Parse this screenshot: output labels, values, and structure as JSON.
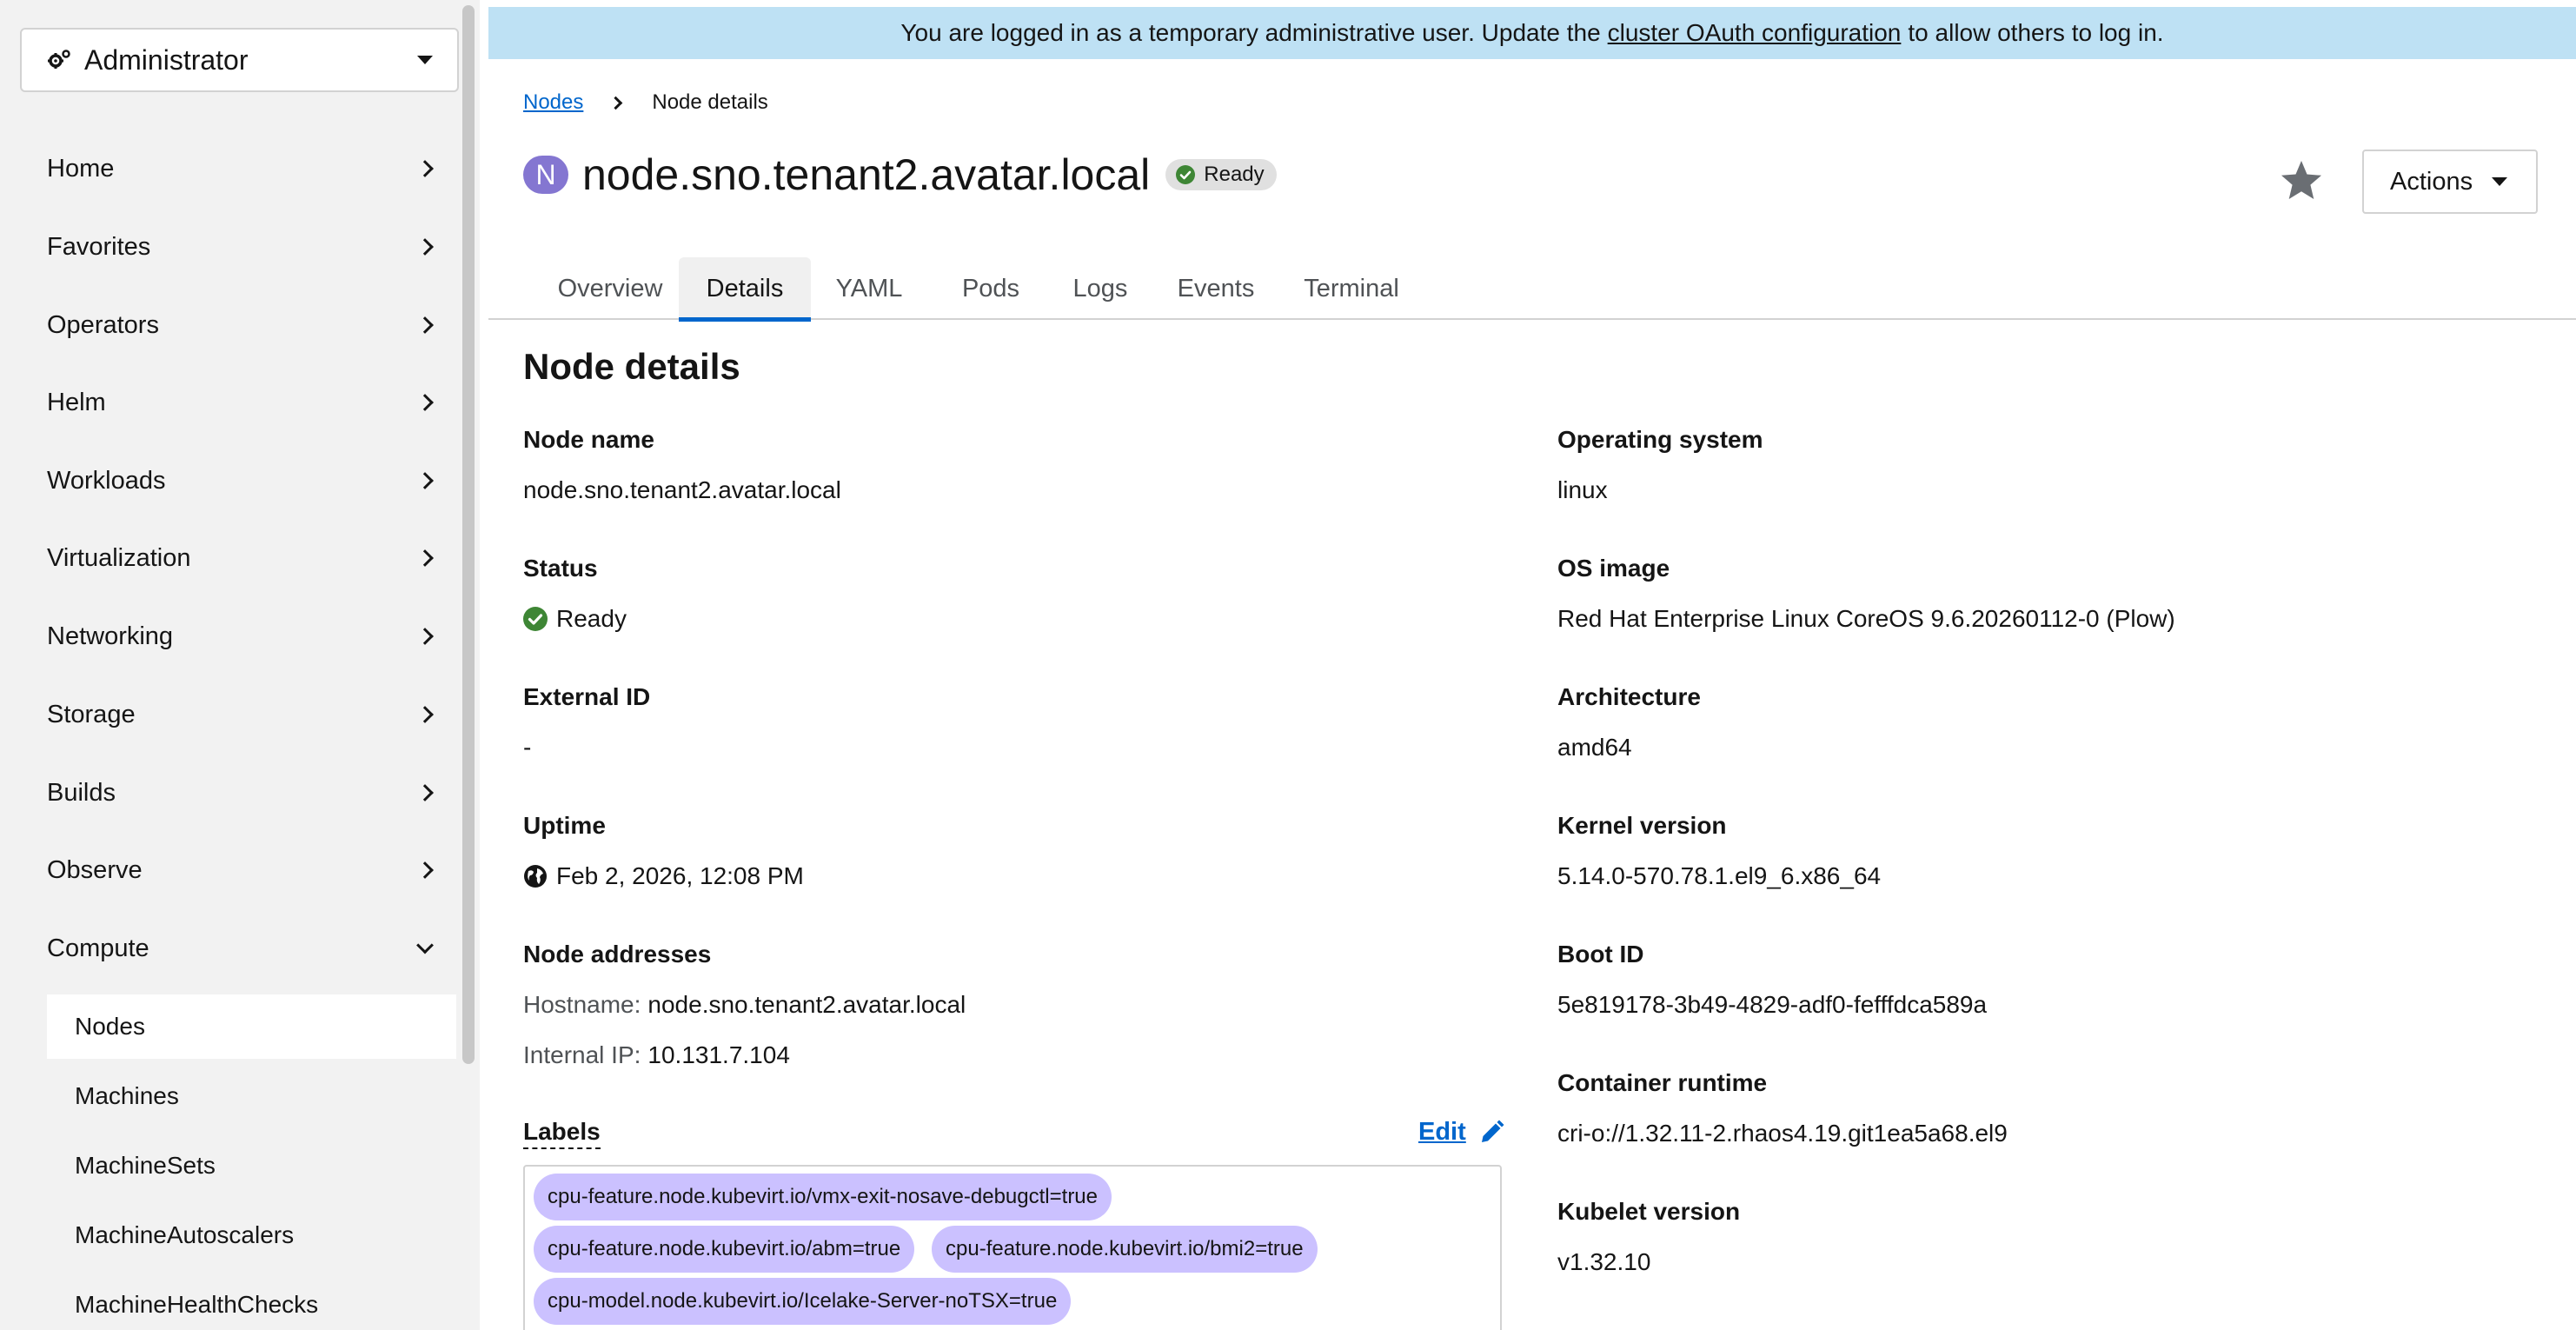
{
  "sidebar": {
    "perspective": "Administrator",
    "items": [
      {
        "label": "Home"
      },
      {
        "label": "Favorites"
      },
      {
        "label": "Operators"
      },
      {
        "label": "Helm"
      },
      {
        "label": "Workloads"
      },
      {
        "label": "Virtualization"
      },
      {
        "label": "Networking"
      },
      {
        "label": "Storage"
      },
      {
        "label": "Builds"
      },
      {
        "label": "Observe"
      },
      {
        "label": "Compute"
      }
    ],
    "compute_items": [
      {
        "label": "Nodes",
        "active": true
      },
      {
        "label": "Machines"
      },
      {
        "label": "MachineSets"
      },
      {
        "label": "MachineAutoscalers"
      },
      {
        "label": "MachineHealthChecks"
      }
    ]
  },
  "banner": {
    "prefix": "You are logged in as a temporary administrative user. Update the",
    "link": "cluster OAuth configuration",
    "suffix": "to allow others to log in."
  },
  "breadcrumb": {
    "parent": "Nodes",
    "current": "Node details"
  },
  "header": {
    "badge": "N",
    "title": "node.sno.tenant2.avatar.local",
    "status": "Ready",
    "actions_label": "Actions"
  },
  "tabs": [
    "Overview",
    "Details",
    "YAML",
    "Pods",
    "Logs",
    "Events",
    "Terminal"
  ],
  "active_tab": "Details",
  "details": {
    "section_title": "Node details",
    "node_name_label": "Node name",
    "node_name": "node.sno.tenant2.avatar.local",
    "status_label": "Status",
    "status": "Ready",
    "external_id_label": "External ID",
    "external_id": "-",
    "uptime_label": "Uptime",
    "uptime": "Feb 2, 2026, 12:08 PM",
    "addresses_label": "Node addresses",
    "hostname_key": "Hostname:",
    "hostname": "node.sno.tenant2.avatar.local",
    "internal_ip_key": "Internal IP:",
    "internal_ip": "10.131.7.104",
    "os_label": "Operating system",
    "os": "linux",
    "os_image_label": "OS image",
    "os_image": "Red Hat Enterprise Linux CoreOS 9.6.20260112-0 (Plow)",
    "arch_label": "Architecture",
    "arch": "amd64",
    "kernel_label": "Kernel version",
    "kernel": "5.14.0-570.78.1.el9_6.x86_64",
    "boot_id_label": "Boot ID",
    "boot_id": "5e819178-3b49-4829-adf0-fefffdca589a",
    "runtime_label": "Container runtime",
    "runtime": "cri-o://1.32.11-2.rhaos4.19.git1ea5a68.el9",
    "kubelet_label": "Kubelet version",
    "kubelet": "v1.32.10"
  },
  "labels": {
    "title": "Labels",
    "edit": "Edit",
    "chips": [
      "cpu-feature.node.kubevirt.io/vmx-exit-nosave-debugctl=true",
      "cpu-feature.node.kubevirt.io/abm=true",
      "cpu-feature.node.kubevirt.io/bmi2=true",
      "cpu-model.node.kubevirt.io/Icelake-Server-noTSX=true"
    ]
  },
  "colors": {
    "banner_bg": "#bee1f4",
    "link": "#0066cc",
    "ready_green": "#3e8635",
    "badge_purple": "#8476d1",
    "chip_purple": "#cbc1ff"
  },
  "icons": {
    "perspective": "cog-icon",
    "status": "check-circle-icon",
    "uptime": "globe-icon",
    "favorite": "star-icon",
    "edit": "pencil-icon"
  }
}
